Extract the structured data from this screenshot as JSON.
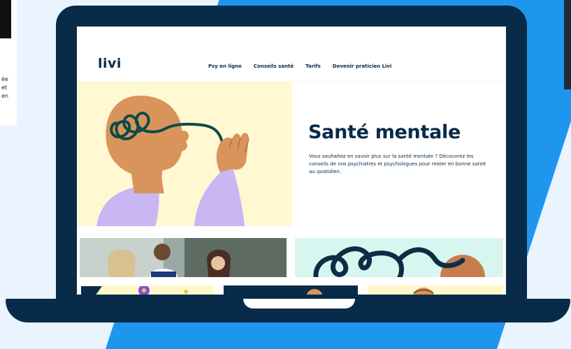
{
  "background_text": "ée\net\nen",
  "site": {
    "logo": "livi",
    "nav": {
      "items": [
        "Psy en ligne",
        "Conseils santé",
        "Tarifs",
        "Devenir praticien Livi"
      ]
    },
    "hero": {
      "title": "Santé mentale",
      "description": "Vous souhaitez en savoir plus sur la santé mentale ? Découvrez les conseils de nos psychiatres et psychologues pour rester en bonne santé au quotidien."
    }
  },
  "colors": {
    "navy": "#082b49",
    "brand_blue": "#1f96ee",
    "hero_bg": "#fff8d1",
    "head": "#d8945b",
    "arm": "#c8b7f3"
  }
}
